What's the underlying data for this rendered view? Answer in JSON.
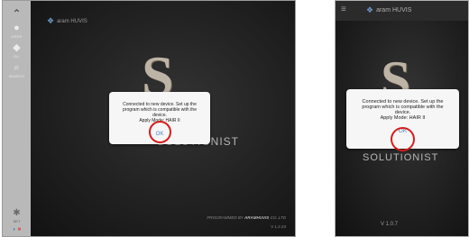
{
  "tablet": {
    "brand": "aram HUVIS",
    "sidebar": {
      "items": [
        {
          "icon": "chevron-up-icon",
          "label": ""
        },
        {
          "icon": "user-icon",
          "label": "USER"
        },
        {
          "icon": "drop-icon",
          "label": "OIL"
        },
        {
          "icon": "search-icon",
          "label": "SEARCH"
        }
      ],
      "settings_label": "SET"
    },
    "logo_letter": "S",
    "app_name": "SOLUTIONIST",
    "dialog": {
      "message_lines": [
        "Connected to new device. Set up the",
        "program which is compatible with the",
        "device.",
        "Apply Mode: HAIR II"
      ],
      "ok_label": "OK"
    },
    "programmed_prefix": "PROGRAMMED BY",
    "programmed_company": "ARAMHUVIS",
    "programmed_suffix": "CO.,LTD",
    "version": "V 1.2.23"
  },
  "phone": {
    "brand": "aram HUVIS",
    "logo_letter": "S",
    "app_name": "SOLUTIONIST",
    "dialog": {
      "message_lines": [
        "Connected to new device. Set up the",
        "program which is compatible with the",
        "device.",
        "Apply Mode: HAIR II"
      ],
      "ok_label": "OK"
    },
    "version": "V 1.0.7"
  },
  "colors": {
    "highlight_ring": "#d61d1d",
    "ok_text": "#4b86c8",
    "sidebar": "#b9b9b9"
  }
}
